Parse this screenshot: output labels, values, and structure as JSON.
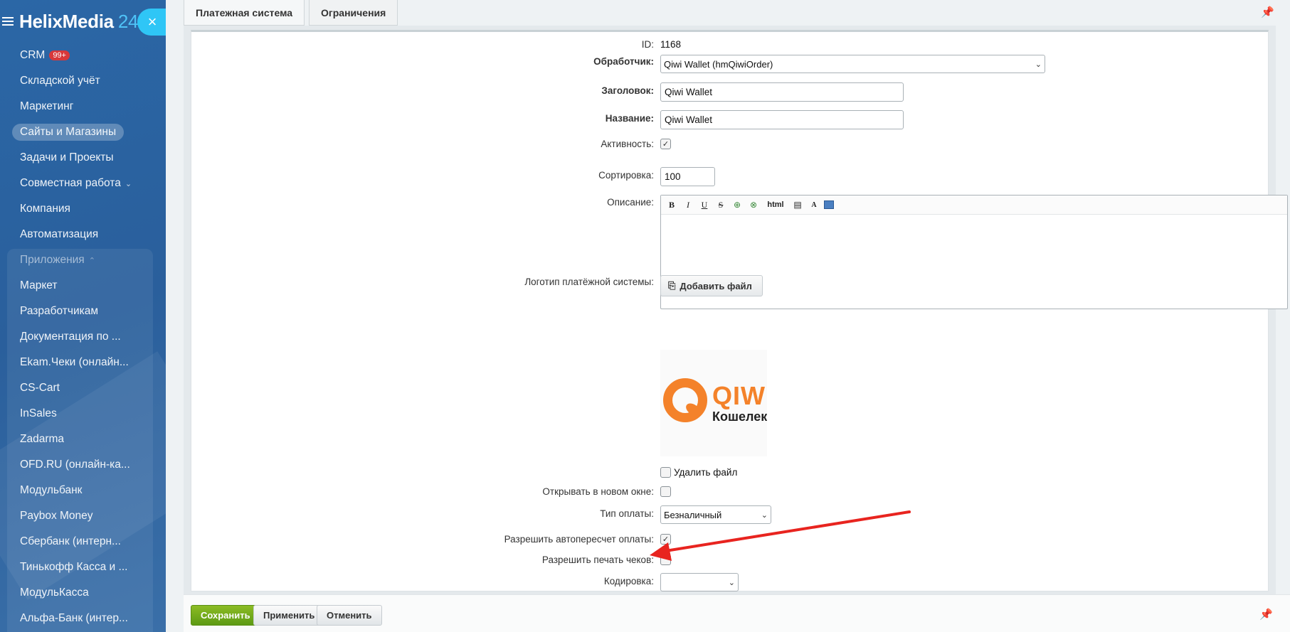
{
  "sidebar": {
    "logo": "HelixMedia",
    "logo_num": "24",
    "close": "×",
    "items": [
      {
        "label": "CRM",
        "badge": "99+"
      },
      {
        "label": "Складской учёт"
      },
      {
        "label": "Маркетинг"
      },
      {
        "label": "Сайты и Магазины"
      },
      {
        "label": "Задачи и Проекты"
      },
      {
        "label": "Совместная работа",
        "chev": "⌄"
      },
      {
        "label": "Компания"
      },
      {
        "label": "Автоматизация"
      },
      {
        "label": "Приложения",
        "chev": "⌃"
      },
      {
        "label": "Маркет"
      },
      {
        "label": "Разработчикам"
      },
      {
        "label": "Документация по ..."
      },
      {
        "label": "Ekam.Чеки (онлайн..."
      },
      {
        "label": "CS-Cart"
      },
      {
        "label": "InSales"
      },
      {
        "label": "Zadarma"
      },
      {
        "label": "OFD.RU (онлайн-ка..."
      },
      {
        "label": "Модульбанк"
      },
      {
        "label": "Paybox Money"
      },
      {
        "label": "Сбербанк (интерн..."
      },
      {
        "label": "Тинькофф Касса и ..."
      },
      {
        "label": "МодульКасса"
      },
      {
        "label": "Альфа-Банк (интер..."
      }
    ]
  },
  "tabs": [
    "Платежная система",
    "Ограничения"
  ],
  "form": {
    "id_label": "ID:",
    "id_value": "1168",
    "handler_label": "Обработчик:",
    "handler_value": "Qiwi Wallet (hmQiwiOrder)",
    "header_label": "Заголовок:",
    "header_value": "Qiwi Wallet",
    "name_label": "Название:",
    "name_value": "Qiwi Wallet",
    "active_label": "Активность:",
    "sort_label": "Сортировка:",
    "sort_value": "100",
    "desc_label": "Описание:",
    "toolbar": {
      "bold": "B",
      "italic": "I",
      "underline": "U",
      "strike": "S",
      "html": "html"
    },
    "logo_label": "Логотип платёжной системы:",
    "add_file": "Добавить файл",
    "qiwi_word": "QIWI",
    "qiwi_sub": "Кошелек",
    "delete_file": "Удалить файл",
    "new_window_label": "Открывать в новом окне:",
    "pay_type_label": "Тип оплаты:",
    "pay_type_value": "Безналичный",
    "autorecalc_label": "Разрешить автопересчет оплаты:",
    "print_label": "Разрешить печать чеков:",
    "encoding_label": "Кодировка:"
  },
  "footer": {
    "save": "Сохранить",
    "apply": "Применить",
    "cancel": "Отменить"
  },
  "colors": {
    "arrow": "#e8241f",
    "save_btn": "#6fa81a",
    "sidebar": "#2b67a6"
  }
}
